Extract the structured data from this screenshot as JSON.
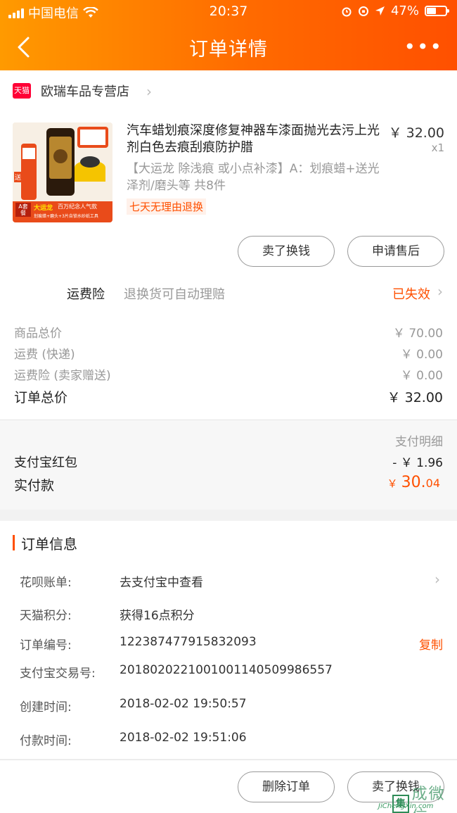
{
  "status_bar": {
    "carrier": "中国电信",
    "time": "20:37",
    "battery": "47%"
  },
  "nav": {
    "title": "订单详情",
    "more": "•••"
  },
  "shop": {
    "badge": "天猫",
    "name": "欧瑞车品专营店"
  },
  "product": {
    "title": "汽车蜡划痕深度修复神器车漆面抛光去污上光剂白色去痕刮痕防护腊",
    "spec": "【大运龙 除浅痕 或小点补漆】A：划痕蜡+送光泽剂/磨头等 共8件",
    "tag": "七天无理由退换",
    "price": "￥ 32.00",
    "qty": "x1",
    "thumb_text_1": "大运龙",
    "thumb_text_2": "百万纪念人气款",
    "thumb_text_3": "划痕蜡+磨头+3片自锁水砂纸工具",
    "thumb_badge": "A套餐",
    "thumb_side": "送"
  },
  "product_buttons": {
    "sell": "卖了换钱",
    "after_sale": "申请售后"
  },
  "insurance": {
    "label": "运费险",
    "desc": "退换货可自动理赔",
    "status": "已失效"
  },
  "summary": {
    "goods_total_label": "商品总价",
    "goods_total": "￥ 70.00",
    "shipping_label": "运费 (快递)",
    "shipping": "￥ 0.00",
    "ins_label": "运费险 (卖家赠送)",
    "ins": "￥ 0.00",
    "order_total_label": "订单总价",
    "order_total": "￥ 32.00"
  },
  "payment": {
    "detail_label": "支付明细",
    "redpacket_label": "支付宝红包",
    "redpacket": "- ￥ 1.96",
    "paid_label": "实付款",
    "paid_currency": "￥",
    "paid_int": "30.",
    "paid_dec": "04"
  },
  "order_info": {
    "title": "订单信息",
    "rows": [
      {
        "key": "花呗账单:",
        "value": "去支付宝中查看"
      },
      {
        "key": "天猫积分:",
        "value": "获得16点积分"
      },
      {
        "key": "订单编号:",
        "value": "122387477915832093",
        "action": "复制"
      },
      {
        "key": "支付宝交易号:",
        "value": "2018020221001001140509986557"
      },
      {
        "key": "创建时间:",
        "value": "2018-02-02 19:50:57"
      },
      {
        "key": "付款时间:",
        "value": "2018-02-02 19:51:06"
      }
    ]
  },
  "footer": {
    "delete": "删除订单",
    "sell": "卖了换钱"
  },
  "watermark": {
    "box": "集",
    "cn": "成微信",
    "en": "JiChengXin.com"
  },
  "colors": {
    "accent": "#ff5000",
    "header_start": "#ff9a00",
    "header_end": "#ff5000",
    "tmall_red": "#ff0036"
  }
}
